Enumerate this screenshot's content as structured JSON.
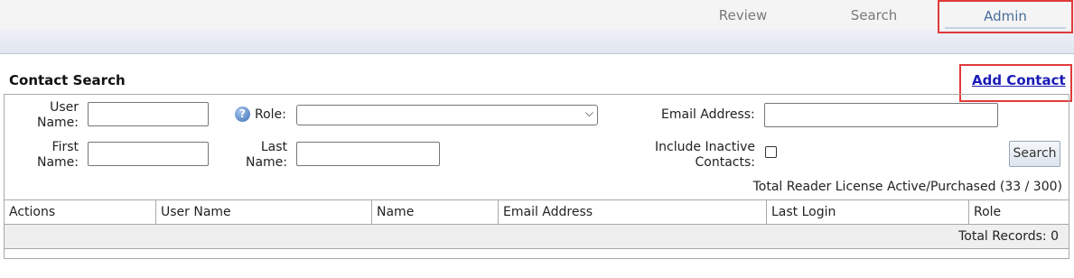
{
  "nav": {
    "tabs": [
      {
        "label": "Review"
      },
      {
        "label": "Search"
      },
      {
        "label": "Admin"
      }
    ]
  },
  "page": {
    "title": "Contact Search",
    "add_contact": "Add Contact"
  },
  "form": {
    "user_name_label": "User Name:",
    "user_name_value": "",
    "role_label": "Role:",
    "role_value": "",
    "email_label": "Email Address:",
    "email_value": "",
    "first_name_label": "First Name:",
    "first_name_value": "",
    "last_name_label": "Last Name:",
    "last_name_value": "",
    "inactive_label": "Include Inactive Contacts:",
    "inactive_checked": false,
    "search_button": "Search",
    "license_text": "Total Reader License Active/Purchased (33 / 300)"
  },
  "grid": {
    "columns": [
      "Actions",
      "User Name",
      "Name",
      "Email Address",
      "Last Login",
      "Role"
    ],
    "total_records": "Total Records: 0"
  },
  "colors": {
    "highlight": "#e03a3a",
    "link": "#1b1bb8",
    "active_tab": "#4a6e9c"
  },
  "icons": [
    "help-icon",
    "chevron-down-icon"
  ]
}
